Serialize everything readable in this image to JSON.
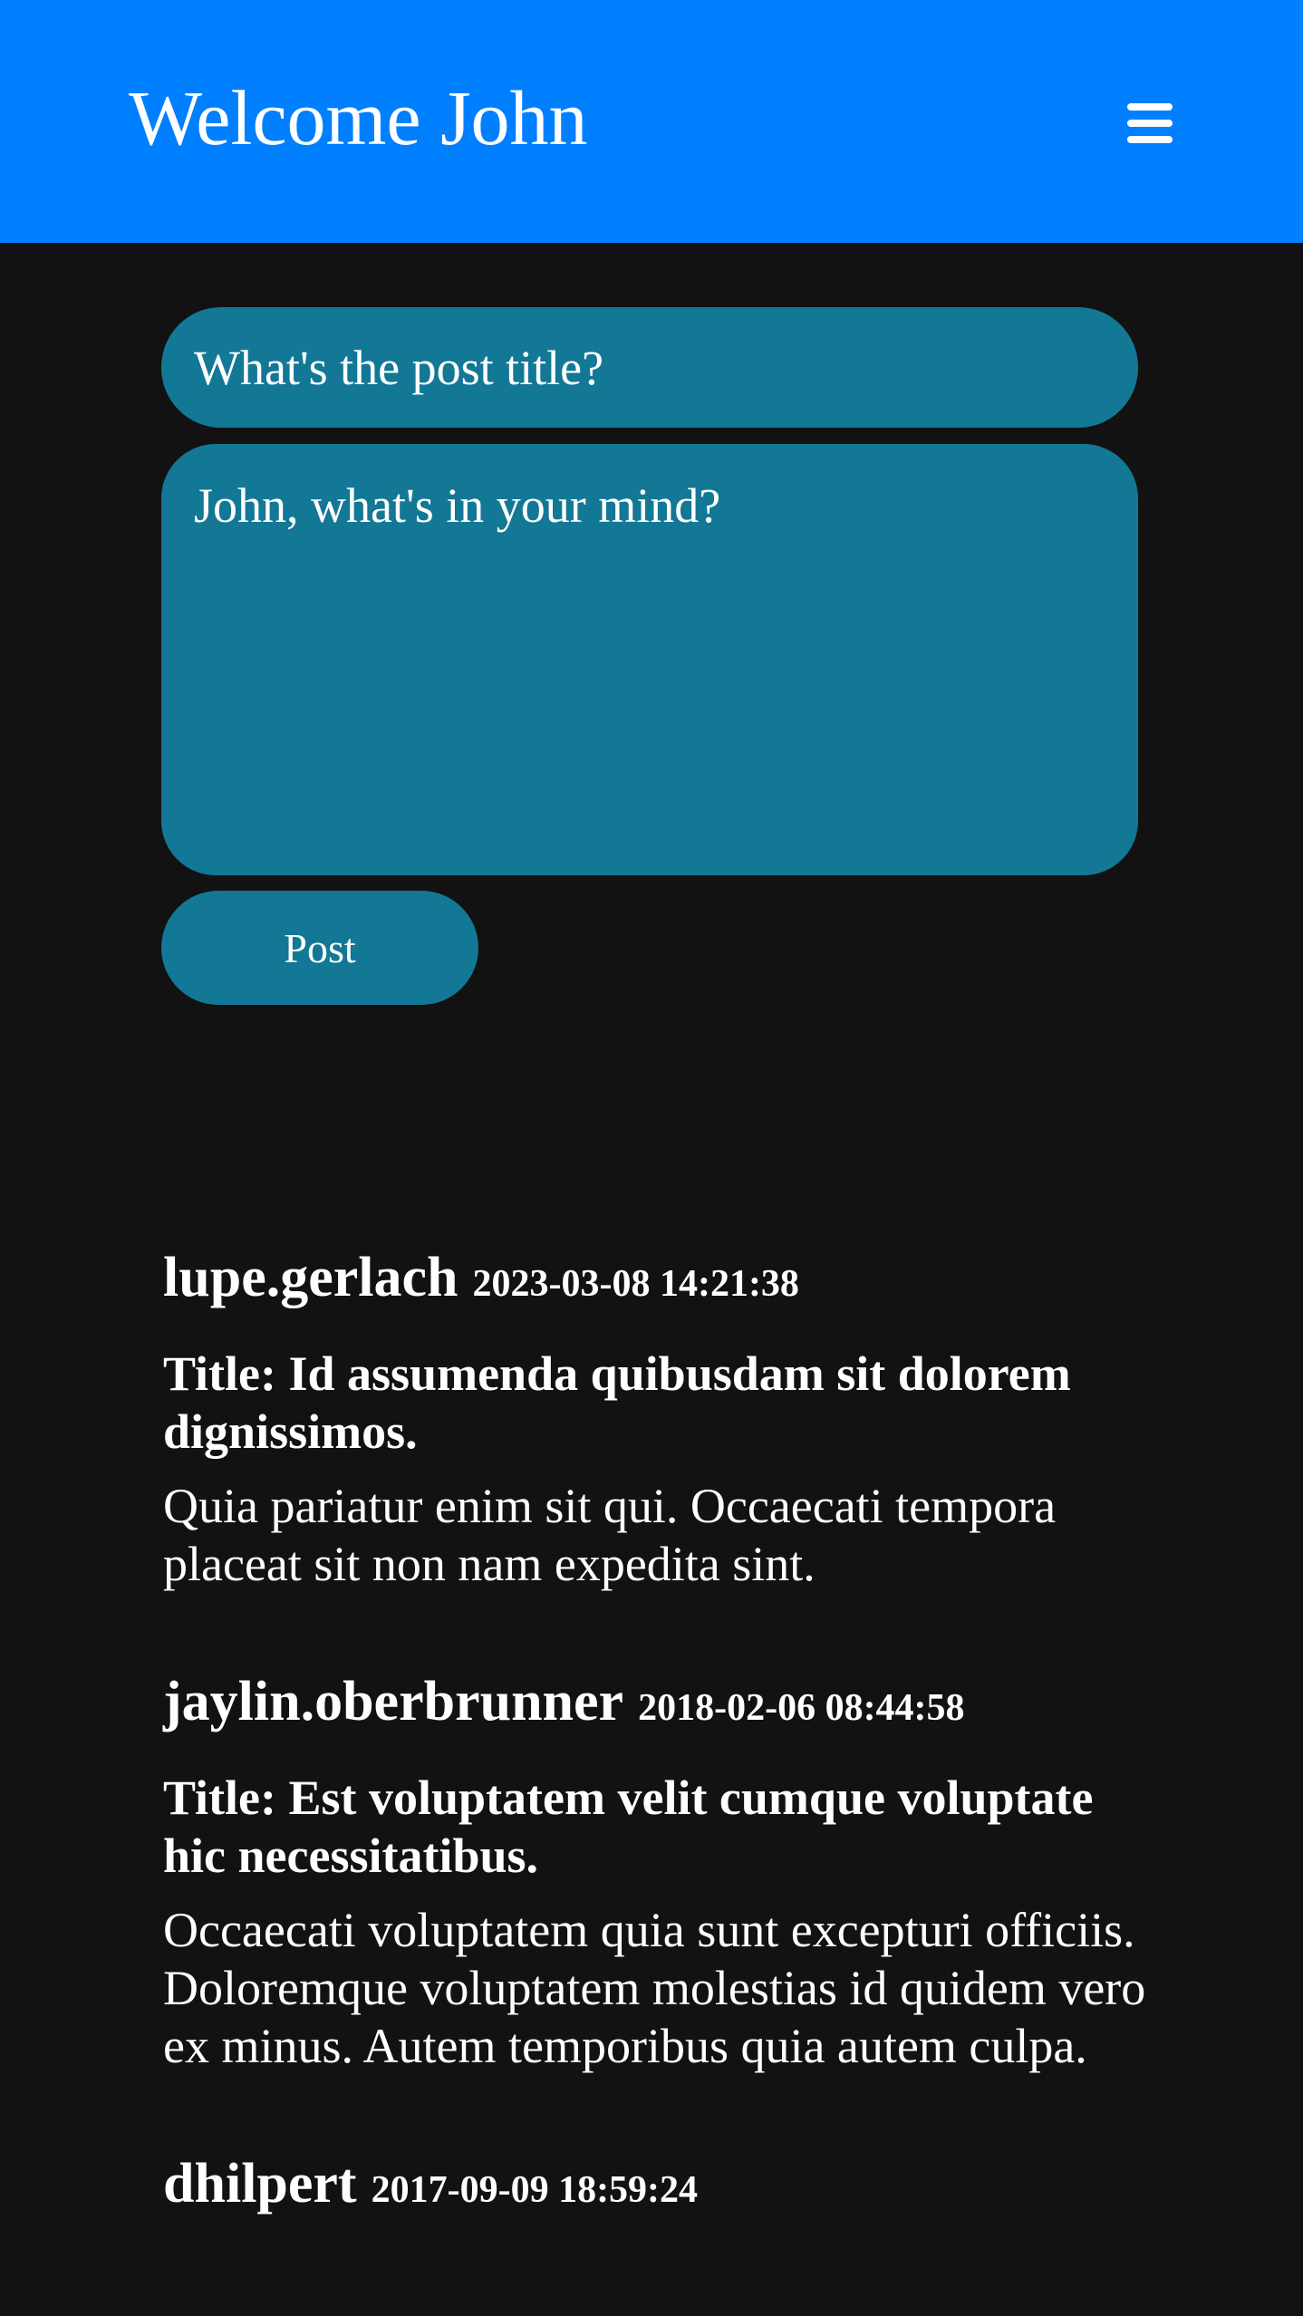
{
  "header": {
    "title": "Welcome John",
    "menu_icon": "hamburger-menu-icon",
    "background": "#0080ff"
  },
  "composer": {
    "title_placeholder": "What's the post title?",
    "body_placeholder": "John, what's in your mind?",
    "post_label": "Post",
    "field_color": "#127896"
  },
  "posts": [
    {
      "author": "lupe.gerlach",
      "date": "2023-03-08 14:21:38",
      "title": "Title: Id assumenda quibusdam sit dolorem dignissimos.",
      "body": "Quia pariatur enim sit qui. Occaecati tempora placeat sit non nam expedita sint."
    },
    {
      "author": "jaylin.oberbrunner",
      "date": "2018-02-06 08:44:58",
      "title": "Title: Est voluptatem velit cumque voluptate hic necessitatibus.",
      "body": "Occaecati voluptatem quia sunt excepturi officiis. Doloremque voluptatem molestias id quidem vero ex minus. Autem temporibus quia autem culpa."
    },
    {
      "author": "dhilpert",
      "date": "2017-09-09 18:59:24",
      "title": "",
      "body": ""
    }
  ]
}
